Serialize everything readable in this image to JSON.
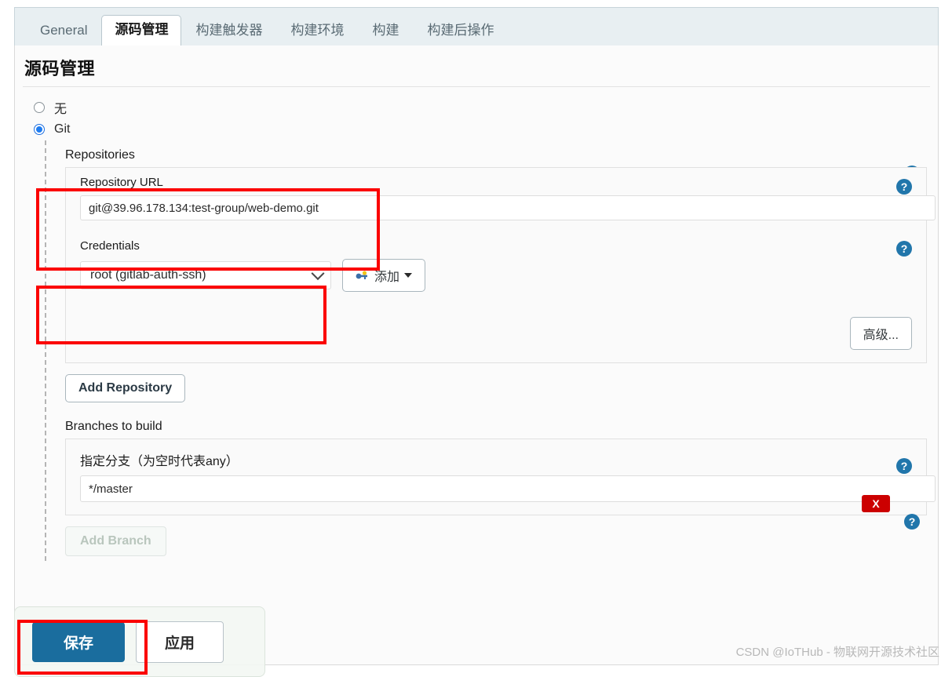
{
  "tabs": [
    {
      "label": "General",
      "active": false
    },
    {
      "label": "源码管理",
      "active": true
    },
    {
      "label": "构建触发器",
      "active": false
    },
    {
      "label": "构建环境",
      "active": false
    },
    {
      "label": "构建",
      "active": false
    },
    {
      "label": "构建后操作",
      "active": false
    }
  ],
  "page": {
    "section_title": "源码管理"
  },
  "scm": {
    "options": [
      {
        "label": "无",
        "selected": false
      },
      {
        "label": "Git",
        "selected": true
      }
    ]
  },
  "git": {
    "repositories_label": "Repositories",
    "repository_url_label": "Repository URL",
    "repository_url_value": "git@39.96.178.134:test-group/web-demo.git",
    "credentials_label": "Credentials",
    "credentials_value": "root (gitlab-auth-ssh)",
    "add_credentials_label": "添加",
    "advanced_label": "高级...",
    "add_repository_label": "Add Repository",
    "branches_label": "Branches to build",
    "branch_specifier_label": "指定分支（为空时代表any）",
    "branch_specifier_value": "*/master",
    "add_branch_label": "Add Branch",
    "delete_label": "X"
  },
  "icons": {
    "help": "?",
    "key": "key-icon",
    "caret": "chevron-down-icon"
  },
  "footer": {
    "save_label": "保存",
    "apply_label": "应用"
  },
  "watermark": {
    "text": "CSDN @IoTHub - 物联网开源技术社区"
  },
  "colors": {
    "accent": "#1a6d9e",
    "help_blue": "#2176ab",
    "danger": "#cc0000",
    "highlight": "#fb0000",
    "radio_blue": "#1f7cf0"
  }
}
